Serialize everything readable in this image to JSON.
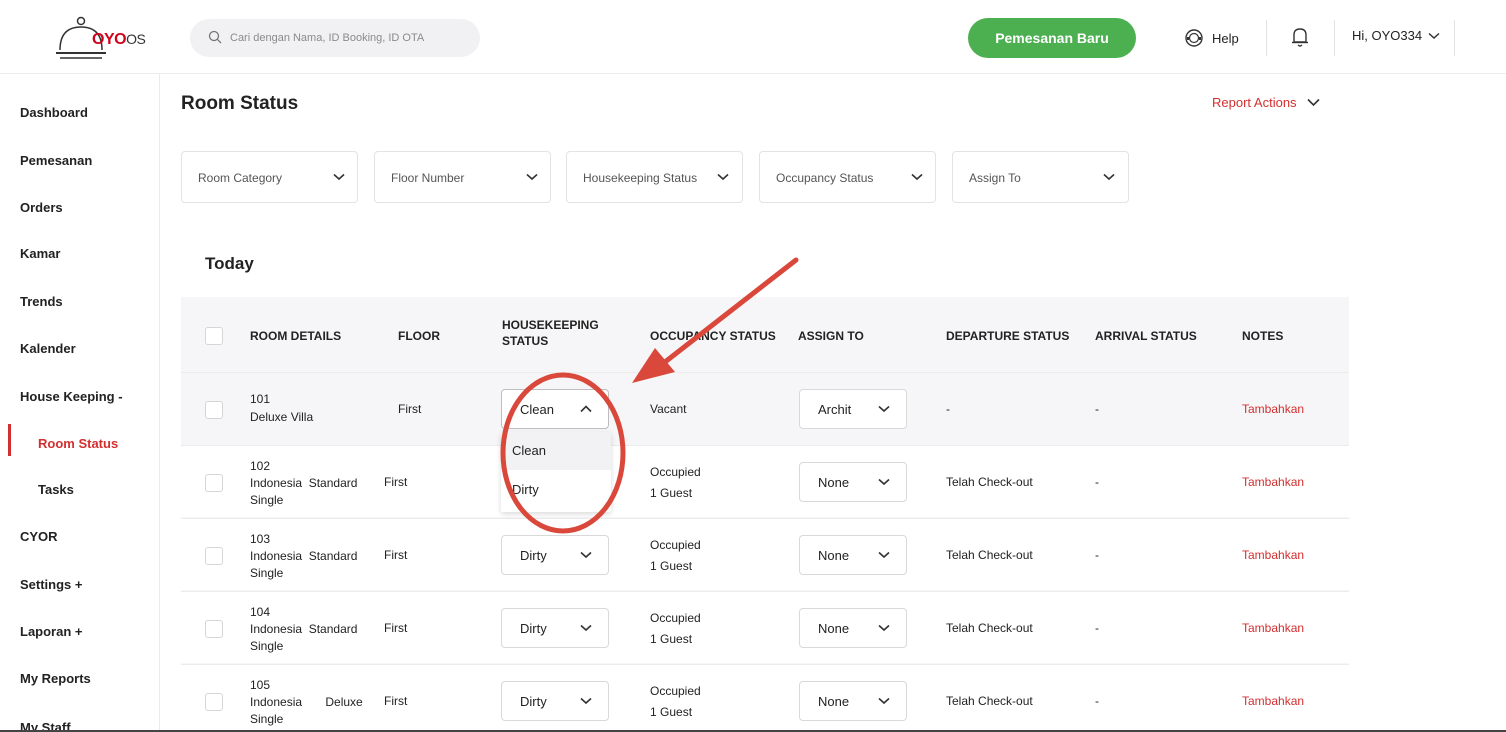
{
  "brand": {
    "logo": "OYO",
    "logo_suffix": "OS"
  },
  "search": {
    "placeholder": "Cari dengan Nama, ID Booking, ID OTA"
  },
  "header": {
    "new_booking": "Pemesanan Baru",
    "help": "Help",
    "user": "Hi, OYO334"
  },
  "sidebar": {
    "items": [
      "Dashboard",
      "Pemesanan",
      "Orders",
      "Kamar",
      "Trends",
      "Kalender",
      "House Keeping  -",
      "Room Status",
      "Tasks",
      "CYOR",
      "Settings  +",
      "Laporan  +",
      "My Reports",
      "My Staff"
    ]
  },
  "page": {
    "title": "Room Status",
    "report_actions": "Report Actions"
  },
  "filters": [
    "Room Category",
    "Floor Number",
    "Housekeeping Status",
    "Occupancy Status",
    "Assign To"
  ],
  "card": {
    "title": "Today"
  },
  "columns": {
    "room_details": "ROOM DETAILS",
    "floor": "FLOOR",
    "housekeeping_1": "HOUSEKEEPING",
    "housekeeping_2": "STATUS",
    "occupancy": "OCCUPANCY STATUS",
    "assign": "ASSIGN TO",
    "departure": "DEPARTURE STATUS",
    "arrival": "ARRIVAL STATUS",
    "notes": "NOTES"
  },
  "rows": [
    {
      "num": "101",
      "name1": "Deluxe Villa",
      "name2": "",
      "floor": "First",
      "hk": "Clean",
      "occ1": "Vacant",
      "occ2": "",
      "assign": "Archit",
      "departure": "-",
      "arrival": "-",
      "notes": "Tambahkan"
    },
    {
      "num": "102",
      "name1": "Indonesia  Standard",
      "name2": "Single",
      "floor": "First",
      "hk": "Dirty",
      "occ1": "Occupied",
      "occ2": "1 Guest",
      "assign": "None",
      "departure": "Telah Check-out",
      "arrival": "-",
      "notes": "Tambahkan"
    },
    {
      "num": "103",
      "name1": "Indonesia  Standard",
      "name2": "Single",
      "floor": "First",
      "hk": "Dirty",
      "occ1": "Occupied",
      "occ2": "1 Guest",
      "assign": "None",
      "departure": "Telah Check-out",
      "arrival": "-",
      "notes": "Tambahkan"
    },
    {
      "num": "104",
      "name1": "Indonesia  Standard",
      "name2": "Single",
      "floor": "First",
      "hk": "Dirty",
      "occ1": "Occupied",
      "occ2": "1 Guest",
      "assign": "None",
      "departure": "Telah Check-out",
      "arrival": "-",
      "notes": "Tambahkan"
    },
    {
      "num": "105",
      "name1": "Indonesia       Deluxe",
      "name2": "Single",
      "floor": "First",
      "hk": "Dirty",
      "occ1": "Occupied",
      "occ2": "1 Guest",
      "assign": "None",
      "departure": "Telah Check-out",
      "arrival": "-",
      "notes": "Tambahkan"
    }
  ],
  "dropdown": {
    "options": [
      "Clean",
      "Dirty"
    ]
  },
  "colors": {
    "accent_red": "#d32f2f",
    "primary_green": "#4caf50",
    "annotation": "#d9483b"
  }
}
